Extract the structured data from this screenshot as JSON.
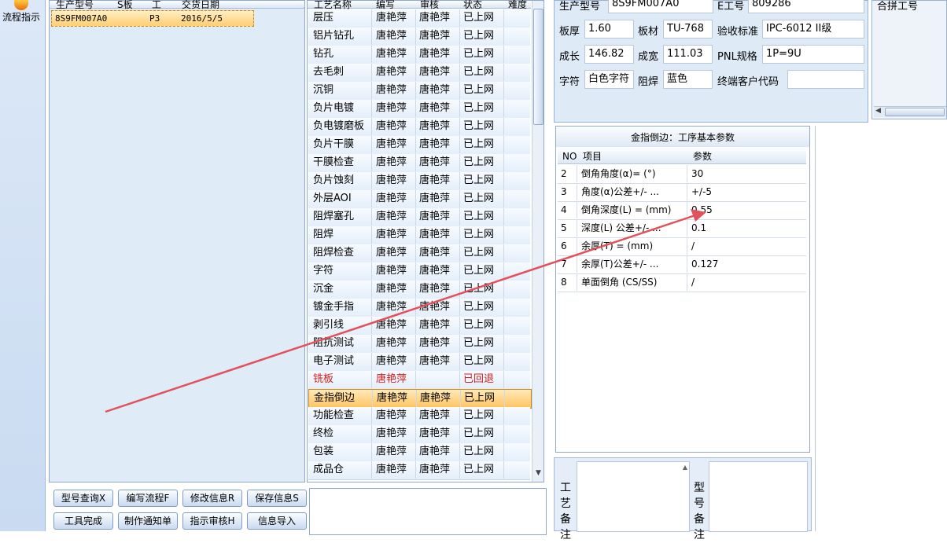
{
  "sidebar": {
    "flow_label": "流程指示"
  },
  "model_list": {
    "headers": [
      "生产型号",
      "S板",
      "工",
      "交货日期"
    ],
    "rows": [
      {
        "model": "8S9FM007A0",
        "layer": "P3",
        "date": "2016/5/5"
      }
    ]
  },
  "process_list": {
    "headers": [
      "工艺名称",
      "编写",
      "审核",
      "状态",
      "难度"
    ],
    "rows": [
      {
        "name": "层压",
        "writer": "唐艳萍",
        "reviewer": "唐艳萍",
        "status": "已上网"
      },
      {
        "name": "铝片钻孔",
        "writer": "唐艳萍",
        "reviewer": "唐艳萍",
        "status": "已上网"
      },
      {
        "name": "钻孔",
        "writer": "唐艳萍",
        "reviewer": "唐艳萍",
        "status": "已上网"
      },
      {
        "name": "去毛刺",
        "writer": "唐艳萍",
        "reviewer": "唐艳萍",
        "status": "已上网"
      },
      {
        "name": "沉铜",
        "writer": "唐艳萍",
        "reviewer": "唐艳萍",
        "status": "已上网"
      },
      {
        "name": "负片电镀",
        "writer": "唐艳萍",
        "reviewer": "唐艳萍",
        "status": "已上网"
      },
      {
        "name": "负电镀磨板",
        "writer": "唐艳萍",
        "reviewer": "唐艳萍",
        "status": "已上网"
      },
      {
        "name": "负片干膜",
        "writer": "唐艳萍",
        "reviewer": "唐艳萍",
        "status": "已上网"
      },
      {
        "name": "干膜检查",
        "writer": "唐艳萍",
        "reviewer": "唐艳萍",
        "status": "已上网"
      },
      {
        "name": "负片蚀刻",
        "writer": "唐艳萍",
        "reviewer": "唐艳萍",
        "status": "已上网"
      },
      {
        "name": "外层AOI",
        "writer": "唐艳萍",
        "reviewer": "唐艳萍",
        "status": "已上网"
      },
      {
        "name": "阻焊塞孔",
        "writer": "唐艳萍",
        "reviewer": "唐艳萍",
        "status": "已上网"
      },
      {
        "name": "阻焊",
        "writer": "唐艳萍",
        "reviewer": "唐艳萍",
        "status": "已上网"
      },
      {
        "name": "阻焊检查",
        "writer": "唐艳萍",
        "reviewer": "唐艳萍",
        "status": "已上网"
      },
      {
        "name": "字符",
        "writer": "唐艳萍",
        "reviewer": "唐艳萍",
        "status": "已上网"
      },
      {
        "name": "沉金",
        "writer": "唐艳萍",
        "reviewer": "唐艳萍",
        "status": "已上网"
      },
      {
        "name": "镀金手指",
        "writer": "唐艳萍",
        "reviewer": "唐艳萍",
        "status": "已上网"
      },
      {
        "name": "剥引线",
        "writer": "唐艳萍",
        "reviewer": "唐艳萍",
        "status": "已上网"
      },
      {
        "name": "阻抗测试",
        "writer": "唐艳萍",
        "reviewer": "唐艳萍",
        "status": "已上网"
      },
      {
        "name": "电子测试",
        "writer": "唐艳萍",
        "reviewer": "唐艳萍",
        "status": "已上网"
      },
      {
        "name": "铣板",
        "writer": "唐艳萍",
        "reviewer": "",
        "status": "已回退"
      },
      {
        "name": "金指倒边",
        "writer": "唐艳萍",
        "reviewer": "唐艳萍",
        "status": "已上网"
      },
      {
        "name": "功能检查",
        "writer": "唐艳萍",
        "reviewer": "唐艳萍",
        "status": "已上网"
      },
      {
        "name": "终检",
        "writer": "唐艳萍",
        "reviewer": "唐艳萍",
        "status": "已上网"
      },
      {
        "name": "包装",
        "writer": "唐艳萍",
        "reviewer": "唐艳萍",
        "status": "已上网"
      },
      {
        "name": "成品仓",
        "writer": "唐艳萍",
        "reviewer": "唐艳萍",
        "status": "已上网"
      }
    ]
  },
  "buttons": {
    "model_query": "型号查询X",
    "write_flow": "编写流程F",
    "modify_info": "修改信息R",
    "save_info": "保存信息S",
    "tool_done": "工具完成",
    "make_notice": "制作通知单",
    "review": "指示审核H",
    "import_info": "信息导入"
  },
  "info": {
    "model_label": "生产型号",
    "model_value": "8S9FM007A0",
    "e_label": "E工号",
    "e_value": "809286",
    "thickness_label": "板厚",
    "thickness_value": "1.60",
    "material_label": "板材",
    "material_value": "TU-768",
    "standard_label": "验收标准",
    "standard_value": "IPC-6012 II级",
    "length_label": "成长",
    "length_value": "146.82",
    "width_label": "成宽",
    "width_value": "111.03",
    "pnl_label": "PNL规格",
    "pnl_value": "1P=9U",
    "char_label": "字符",
    "char_value": "白色字符",
    "mask_label": "阻焊",
    "mask_value": "蓝色",
    "customer_label": "终端客户代码",
    "customer_value": ""
  },
  "right_list": {
    "header": "合拼工号"
  },
  "params": {
    "title": "金指倒边：工序基本参数",
    "headers": [
      "NO",
      "项目",
      "参数"
    ],
    "rows": [
      {
        "no": "2",
        "item": "倒角角度(α)= (°)",
        "value": "30"
      },
      {
        "no": "3",
        "item": "角度(α)公差+/- ...",
        "value": "+/-5"
      },
      {
        "no": "4",
        "item": "倒角深度(L) = (mm)",
        "value": "0.55"
      },
      {
        "no": "5",
        "item": "深度(L) 公差+/- ...",
        "value": "0.1"
      },
      {
        "no": "6",
        "item": "余厚(T) = (mm)",
        "value": "/"
      },
      {
        "no": "7",
        "item": "余厚(T)公差+/- ...",
        "value": "0.127"
      },
      {
        "no": "8",
        "item": "单面倒角 (CS/SS)",
        "value": "/"
      }
    ]
  },
  "remarks": {
    "process_label": "工艺备注",
    "model_label": "型号备注"
  }
}
